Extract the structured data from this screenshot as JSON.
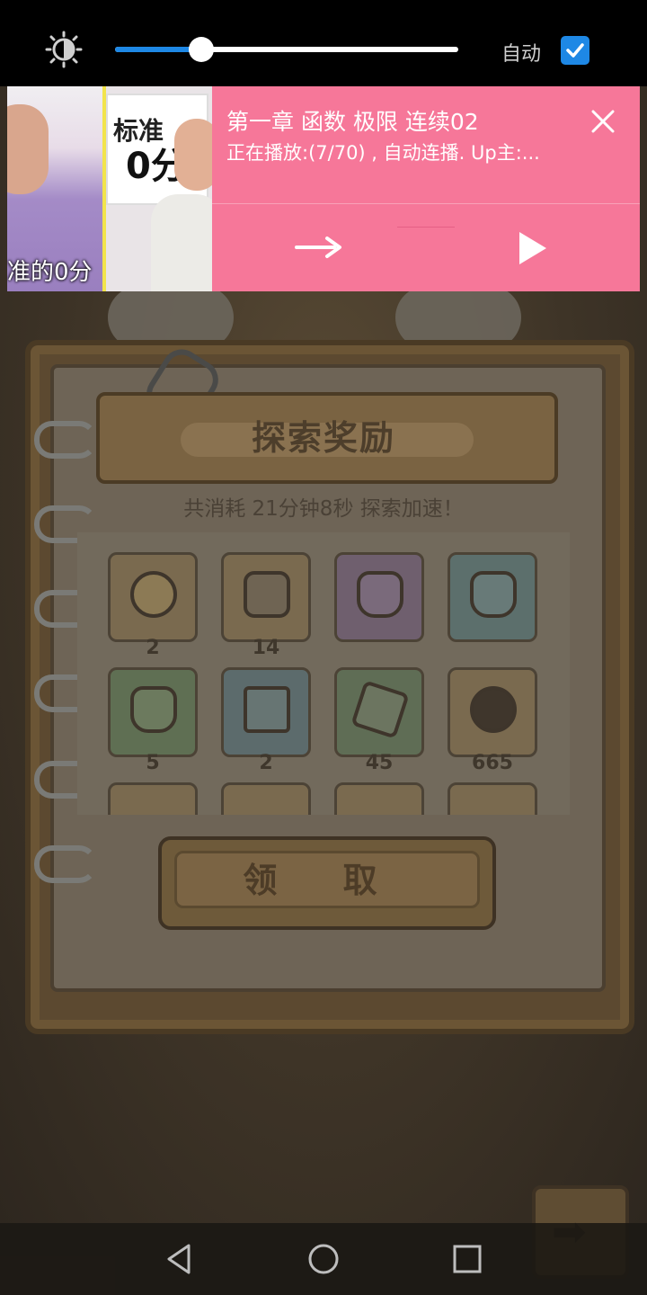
{
  "brightness": {
    "level": 0.25,
    "auto_label": "自动",
    "auto_checked": true,
    "icon": "brightness-icon"
  },
  "notification": {
    "title": "第一章 函数 极限 连续02",
    "subtitle": "正在播放:(7/70) , 自动连播. Up主:...",
    "thumbnail": {
      "sign_line1": "标准",
      "sign_line2": "0分",
      "caption": "准的0分"
    },
    "icons": [
      "close-icon",
      "next-icon",
      "play-icon"
    ],
    "color": "#f67799"
  },
  "game": {
    "title": "探索奖励",
    "description": "共消耗  21分钟8秒  探索加速！",
    "items": [
      {
        "icon": "coin-icon",
        "count": "2"
      },
      {
        "icon": "mechanism-icon",
        "count": "14"
      },
      {
        "icon": "purple-potion-icon",
        "count": ""
      },
      {
        "icon": "cyan-potion-icon",
        "count": ""
      },
      {
        "icon": "green-potion-icon",
        "count": "5"
      },
      {
        "icon": "card-icon",
        "count": "2"
      },
      {
        "icon": "map-fragment-icon",
        "count": "45"
      },
      {
        "icon": "bubble-icon",
        "count": "665"
      }
    ],
    "claim_label": "领 取",
    "next_icon": "arrow-right-icon"
  },
  "navbar": {
    "icons": [
      "back-icon",
      "home-icon",
      "recents-icon"
    ]
  }
}
